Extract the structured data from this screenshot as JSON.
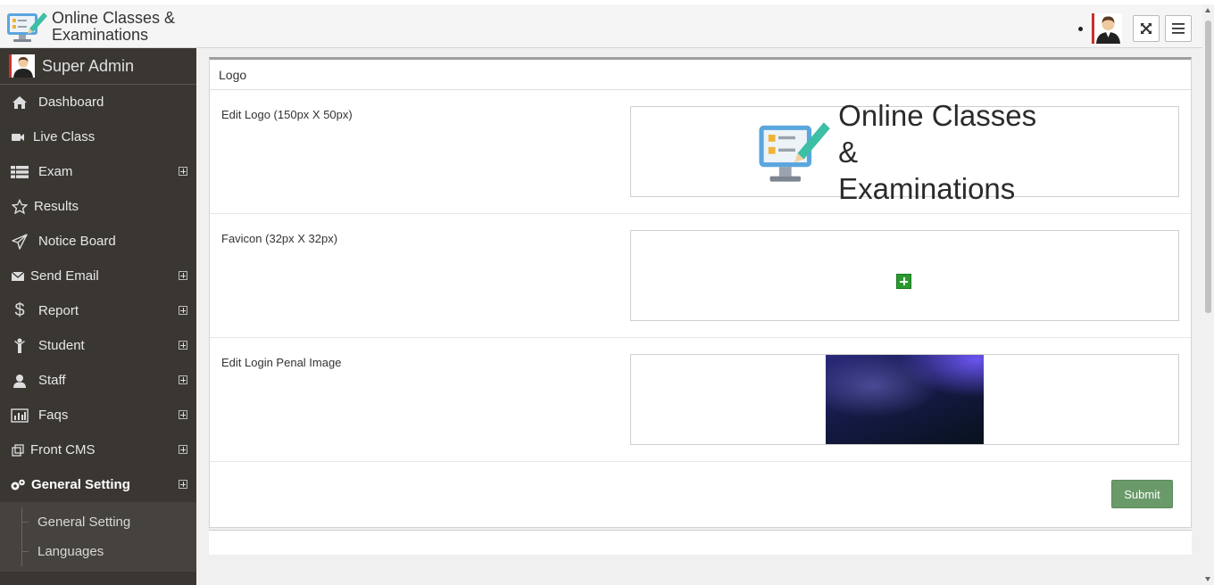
{
  "brand": {
    "line1": "Online Classes &",
    "line2": "Examinations"
  },
  "header": {
    "icons": [
      "user-avatar",
      "fullscreen-icon",
      "hamburger-menu-icon"
    ]
  },
  "sidebar": {
    "user_name": "Super Admin",
    "items": [
      {
        "label": "Dashboard",
        "icon": "home-icon",
        "expandable": false
      },
      {
        "label": "Live Class",
        "icon": "video-camera-icon",
        "expandable": false
      },
      {
        "label": "Exam",
        "icon": "list-icon",
        "expandable": true
      },
      {
        "label": "Results",
        "icon": "star-icon",
        "expandable": false
      },
      {
        "label": "Notice Board",
        "icon": "paper-plane-icon",
        "expandable": false
      },
      {
        "label": "Send Email",
        "icon": "envelope-icon",
        "expandable": true
      },
      {
        "label": "Report",
        "icon": "dollar-icon",
        "expandable": true
      },
      {
        "label": "Student",
        "icon": "student-icon",
        "expandable": true
      },
      {
        "label": "Staff",
        "icon": "user-icon",
        "expandable": true
      },
      {
        "label": "Faqs",
        "icon": "bar-chart-icon",
        "expandable": true
      },
      {
        "label": "Front CMS",
        "icon": "clipboard-icon",
        "expandable": true
      },
      {
        "label": "General Setting",
        "icon": "gears-icon",
        "expandable": true,
        "active": true
      }
    ],
    "submenu": [
      "General Setting",
      "Languages"
    ]
  },
  "panel": {
    "title": "Logo",
    "rows": [
      {
        "label": "Edit Logo (150px X 50px)"
      },
      {
        "label": "Favicon (32px X 32px)"
      },
      {
        "label": "Edit Login Penal Image"
      }
    ],
    "logo_text_line1": "Online Classes &",
    "logo_text_line2": "Examinations",
    "submit_label": "Submit"
  },
  "colors": {
    "sidebar_bg": "#3a3632",
    "submit_bg": "#6a9a6a",
    "accent_red": "#c9302c",
    "favicon_add": "#2a9a2e"
  }
}
